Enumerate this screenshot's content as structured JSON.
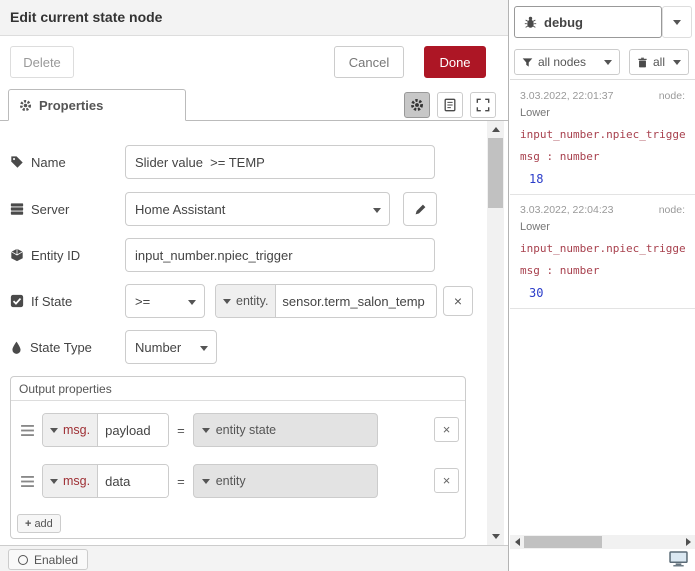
{
  "colors": {
    "done_button": "#AD1625",
    "debug_path_text": "#a8414e",
    "debug_value_number": "#2a3cc9",
    "typed_input_msg_label": "#9e2f34"
  },
  "icons": {
    "close": "×",
    "plus": "+"
  },
  "editor": {
    "title": "Edit current state node",
    "toolbar": {
      "delete": "Delete",
      "cancel": "Cancel",
      "done": "Done"
    },
    "tab": {
      "label": "Properties"
    },
    "form": {
      "name": {
        "label": "Name",
        "value": "Slider value  >= TEMP"
      },
      "server": {
        "label": "Server",
        "value": "Home Assistant"
      },
      "entity_id": {
        "label": "Entity ID",
        "value": "input_number.npiec_trigger"
      },
      "if_state": {
        "label": "If State",
        "operator": ">=",
        "type": "entity.",
        "value": "sensor.term_salon_temp"
      },
      "state_type": {
        "label": "State Type",
        "value": "Number"
      },
      "output": {
        "title": "Output properties",
        "rows": [
          {
            "type": "msg.",
            "name": "payload",
            "equals": "=",
            "value": "entity state"
          },
          {
            "type": "msg.",
            "name": "data",
            "equals": "=",
            "value": "entity"
          }
        ],
        "add_label": "add"
      }
    },
    "footer": {
      "enabled": "Enabled"
    }
  },
  "debug": {
    "title": "debug",
    "filters": {
      "nodes": "all nodes",
      "scope": "all"
    },
    "messages": [
      {
        "timestamp": "3.03.2022, 22:01:37",
        "node_label": "node:",
        "node_name": "Lower",
        "topic": "input_number.npiec_trigger :",
        "path": "msg : number",
        "value": "18"
      },
      {
        "timestamp": "3.03.2022, 22:04:23",
        "node_label": "node:",
        "node_name": "Lower",
        "topic": "input_number.npiec_trigger :",
        "path": "msg : number",
        "value": "30"
      }
    ]
  }
}
